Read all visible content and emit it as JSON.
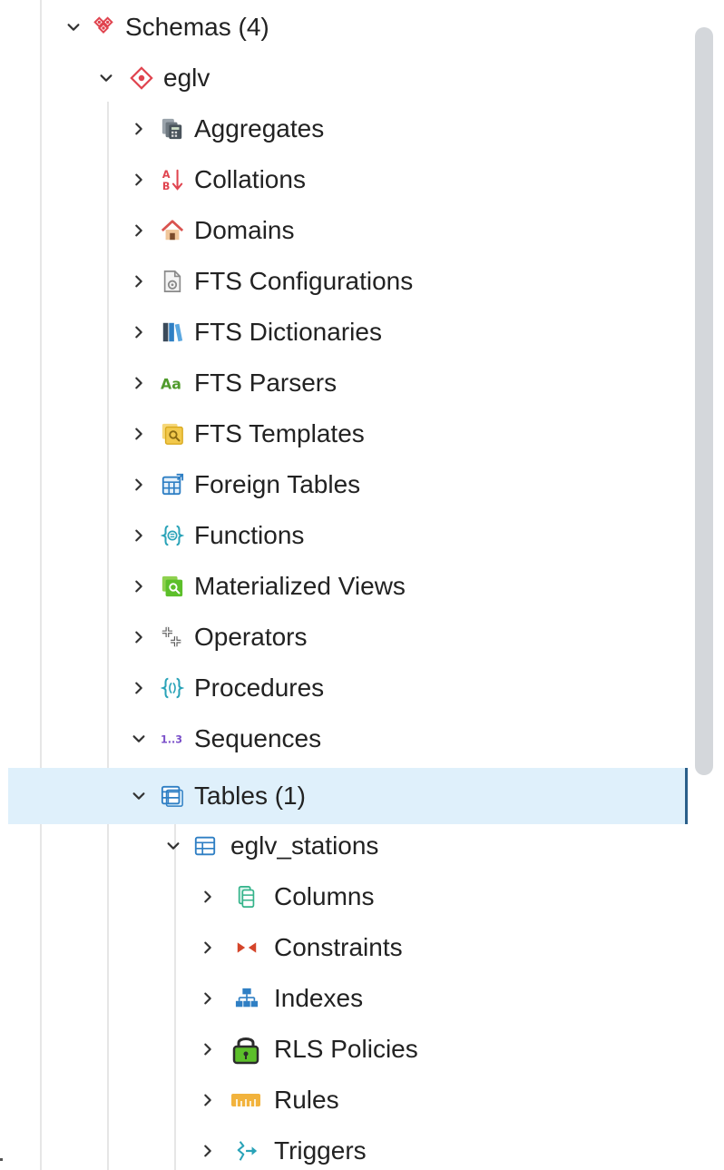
{
  "tree": {
    "schemas": {
      "label": "Schemas (4)",
      "expanded": true,
      "icon": "schemas-icon"
    },
    "schema": {
      "label": "eglv",
      "expanded": true,
      "icon": "schema-icon"
    },
    "nodes": [
      {
        "label": "Aggregates",
        "icon": "aggregates-icon",
        "expanded": false
      },
      {
        "label": "Collations",
        "icon": "collations-icon",
        "expanded": false
      },
      {
        "label": "Domains",
        "icon": "domains-icon",
        "expanded": false
      },
      {
        "label": "FTS Configurations",
        "icon": "fts-configurations-icon",
        "expanded": false
      },
      {
        "label": "FTS Dictionaries",
        "icon": "fts-dictionaries-icon",
        "expanded": false
      },
      {
        "label": "FTS Parsers",
        "icon": "fts-parsers-icon",
        "expanded": false
      },
      {
        "label": "FTS Templates",
        "icon": "fts-templates-icon",
        "expanded": false
      },
      {
        "label": "Foreign Tables",
        "icon": "foreign-tables-icon",
        "expanded": false
      },
      {
        "label": "Functions",
        "icon": "functions-icon",
        "expanded": false
      },
      {
        "label": "Materialized Views",
        "icon": "materialized-views-icon",
        "expanded": false
      },
      {
        "label": "Operators",
        "icon": "operators-icon",
        "expanded": false
      },
      {
        "label": "Procedures",
        "icon": "procedures-icon",
        "expanded": false
      },
      {
        "label": "Sequences",
        "icon": "sequences-icon",
        "expanded": true
      },
      {
        "label": "Tables (1)",
        "icon": "tables-icon",
        "expanded": true,
        "selected": true
      }
    ],
    "table": {
      "label": "eglv_stations",
      "icon": "table-icon",
      "expanded": true
    },
    "table_children": [
      {
        "label": "Columns",
        "icon": "columns-icon",
        "expanded": false
      },
      {
        "label": "Constraints",
        "icon": "constraints-icon",
        "expanded": false
      },
      {
        "label": "Indexes",
        "icon": "indexes-icon",
        "expanded": false
      },
      {
        "label": "RLS Policies",
        "icon": "rls-policies-icon",
        "expanded": false
      },
      {
        "label": "Rules",
        "icon": "rules-icon",
        "expanded": false
      },
      {
        "label": "Triggers",
        "icon": "triggers-icon",
        "expanded": false
      }
    ]
  },
  "colors": {
    "selected_bg": "#dff0fb",
    "selected_border": "#2a5f8a",
    "scrollbar_thumb": "#d4d7db"
  }
}
